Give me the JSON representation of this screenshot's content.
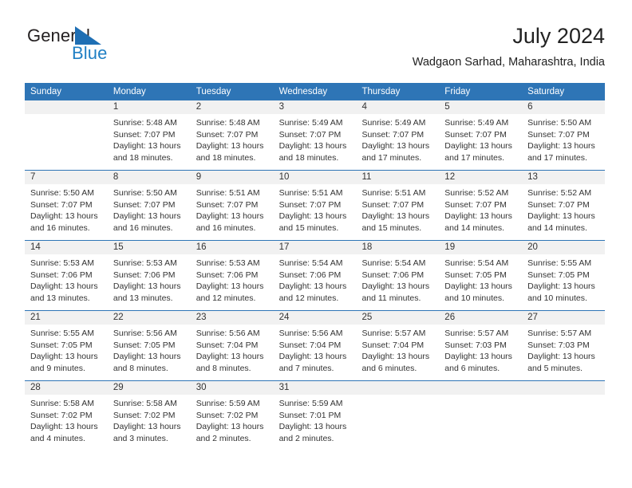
{
  "brand": {
    "name_part1": "General",
    "name_part2": "Blue",
    "accent_color": "#1f7fc4",
    "triangle_icon": "triangle-logo-icon"
  },
  "header": {
    "title": "July 2024",
    "subtitle": "Wadgaon Sarhad, Maharashtra, India"
  },
  "calendar": {
    "header_color": "#2e75b6",
    "weekdays": [
      "Sunday",
      "Monday",
      "Tuesday",
      "Wednesday",
      "Thursday",
      "Friday",
      "Saturday"
    ],
    "weeks": [
      [
        {
          "day": "",
          "lines": []
        },
        {
          "day": "1",
          "lines": [
            "Sunrise: 5:48 AM",
            "Sunset: 7:07 PM",
            "Daylight: 13 hours",
            "and 18 minutes."
          ]
        },
        {
          "day": "2",
          "lines": [
            "Sunrise: 5:48 AM",
            "Sunset: 7:07 PM",
            "Daylight: 13 hours",
            "and 18 minutes."
          ]
        },
        {
          "day": "3",
          "lines": [
            "Sunrise: 5:49 AM",
            "Sunset: 7:07 PM",
            "Daylight: 13 hours",
            "and 18 minutes."
          ]
        },
        {
          "day": "4",
          "lines": [
            "Sunrise: 5:49 AM",
            "Sunset: 7:07 PM",
            "Daylight: 13 hours",
            "and 17 minutes."
          ]
        },
        {
          "day": "5",
          "lines": [
            "Sunrise: 5:49 AM",
            "Sunset: 7:07 PM",
            "Daylight: 13 hours",
            "and 17 minutes."
          ]
        },
        {
          "day": "6",
          "lines": [
            "Sunrise: 5:50 AM",
            "Sunset: 7:07 PM",
            "Daylight: 13 hours",
            "and 17 minutes."
          ]
        }
      ],
      [
        {
          "day": "7",
          "lines": [
            "Sunrise: 5:50 AM",
            "Sunset: 7:07 PM",
            "Daylight: 13 hours",
            "and 16 minutes."
          ]
        },
        {
          "day": "8",
          "lines": [
            "Sunrise: 5:50 AM",
            "Sunset: 7:07 PM",
            "Daylight: 13 hours",
            "and 16 minutes."
          ]
        },
        {
          "day": "9",
          "lines": [
            "Sunrise: 5:51 AM",
            "Sunset: 7:07 PM",
            "Daylight: 13 hours",
            "and 16 minutes."
          ]
        },
        {
          "day": "10",
          "lines": [
            "Sunrise: 5:51 AM",
            "Sunset: 7:07 PM",
            "Daylight: 13 hours",
            "and 15 minutes."
          ]
        },
        {
          "day": "11",
          "lines": [
            "Sunrise: 5:51 AM",
            "Sunset: 7:07 PM",
            "Daylight: 13 hours",
            "and 15 minutes."
          ]
        },
        {
          "day": "12",
          "lines": [
            "Sunrise: 5:52 AM",
            "Sunset: 7:07 PM",
            "Daylight: 13 hours",
            "and 14 minutes."
          ]
        },
        {
          "day": "13",
          "lines": [
            "Sunrise: 5:52 AM",
            "Sunset: 7:07 PM",
            "Daylight: 13 hours",
            "and 14 minutes."
          ]
        }
      ],
      [
        {
          "day": "14",
          "lines": [
            "Sunrise: 5:53 AM",
            "Sunset: 7:06 PM",
            "Daylight: 13 hours",
            "and 13 minutes."
          ]
        },
        {
          "day": "15",
          "lines": [
            "Sunrise: 5:53 AM",
            "Sunset: 7:06 PM",
            "Daylight: 13 hours",
            "and 13 minutes."
          ]
        },
        {
          "day": "16",
          "lines": [
            "Sunrise: 5:53 AM",
            "Sunset: 7:06 PM",
            "Daylight: 13 hours",
            "and 12 minutes."
          ]
        },
        {
          "day": "17",
          "lines": [
            "Sunrise: 5:54 AM",
            "Sunset: 7:06 PM",
            "Daylight: 13 hours",
            "and 12 minutes."
          ]
        },
        {
          "day": "18",
          "lines": [
            "Sunrise: 5:54 AM",
            "Sunset: 7:06 PM",
            "Daylight: 13 hours",
            "and 11 minutes."
          ]
        },
        {
          "day": "19",
          "lines": [
            "Sunrise: 5:54 AM",
            "Sunset: 7:05 PM",
            "Daylight: 13 hours",
            "and 10 minutes."
          ]
        },
        {
          "day": "20",
          "lines": [
            "Sunrise: 5:55 AM",
            "Sunset: 7:05 PM",
            "Daylight: 13 hours",
            "and 10 minutes."
          ]
        }
      ],
      [
        {
          "day": "21",
          "lines": [
            "Sunrise: 5:55 AM",
            "Sunset: 7:05 PM",
            "Daylight: 13 hours",
            "and 9 minutes."
          ]
        },
        {
          "day": "22",
          "lines": [
            "Sunrise: 5:56 AM",
            "Sunset: 7:05 PM",
            "Daylight: 13 hours",
            "and 8 minutes."
          ]
        },
        {
          "day": "23",
          "lines": [
            "Sunrise: 5:56 AM",
            "Sunset: 7:04 PM",
            "Daylight: 13 hours",
            "and 8 minutes."
          ]
        },
        {
          "day": "24",
          "lines": [
            "Sunrise: 5:56 AM",
            "Sunset: 7:04 PM",
            "Daylight: 13 hours",
            "and 7 minutes."
          ]
        },
        {
          "day": "25",
          "lines": [
            "Sunrise: 5:57 AM",
            "Sunset: 7:04 PM",
            "Daylight: 13 hours",
            "and 6 minutes."
          ]
        },
        {
          "day": "26",
          "lines": [
            "Sunrise: 5:57 AM",
            "Sunset: 7:03 PM",
            "Daylight: 13 hours",
            "and 6 minutes."
          ]
        },
        {
          "day": "27",
          "lines": [
            "Sunrise: 5:57 AM",
            "Sunset: 7:03 PM",
            "Daylight: 13 hours",
            "and 5 minutes."
          ]
        }
      ],
      [
        {
          "day": "28",
          "lines": [
            "Sunrise: 5:58 AM",
            "Sunset: 7:02 PM",
            "Daylight: 13 hours",
            "and 4 minutes."
          ]
        },
        {
          "day": "29",
          "lines": [
            "Sunrise: 5:58 AM",
            "Sunset: 7:02 PM",
            "Daylight: 13 hours",
            "and 3 minutes."
          ]
        },
        {
          "day": "30",
          "lines": [
            "Sunrise: 5:59 AM",
            "Sunset: 7:02 PM",
            "Daylight: 13 hours",
            "and 2 minutes."
          ]
        },
        {
          "day": "31",
          "lines": [
            "Sunrise: 5:59 AM",
            "Sunset: 7:01 PM",
            "Daylight: 13 hours",
            "and 2 minutes."
          ]
        },
        {
          "day": "",
          "lines": []
        },
        {
          "day": "",
          "lines": []
        },
        {
          "day": "",
          "lines": []
        }
      ]
    ]
  }
}
